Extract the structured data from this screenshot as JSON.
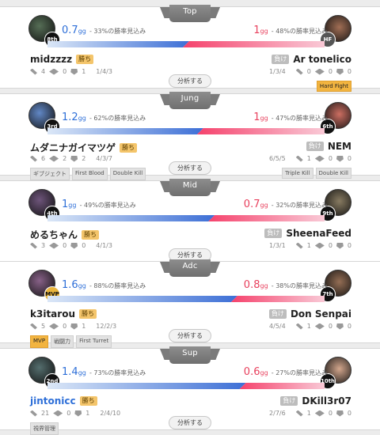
{
  "analyze_label": "分析する",
  "lanes": [
    {
      "role": "Top",
      "left": {
        "gold": "0.7",
        "unit": "gg",
        "winrate": "- 33%の勝率見込み",
        "name": "midzzzz",
        "result": "勝ち",
        "wards": "4",
        "kills": "0",
        "deaths": "1",
        "kda": "1/4/3",
        "rank": "8th",
        "tags": []
      },
      "right": {
        "gold": "1",
        "unit": "gg",
        "winrate": "- 48%の勝率見込み",
        "name": "Ar tonelico",
        "result": "負け",
        "wards": "0",
        "kills": "0",
        "deaths": "0",
        "kda": "1/3/4",
        "rank": "HF",
        "tags": [
          "Hard Fight"
        ]
      },
      "blue_fraction": 0.5
    },
    {
      "role": "Jung",
      "left": {
        "gold": "1.2",
        "unit": "gg",
        "winrate": "- 62%の勝率見込み",
        "name": "ムダニナガイマツゲ",
        "result": "勝ち",
        "wards": "6",
        "kills": "2",
        "deaths": "2",
        "kda": "4/3/7",
        "rank": "3rd",
        "tags": [
          "ギブジェクト",
          "First Blood",
          "Double Kill"
        ]
      },
      "right": {
        "gold": "1",
        "unit": "gg",
        "winrate": "- 47%の勝率見込み",
        "name": "NEM",
        "result": "負け",
        "wards": "1",
        "kills": "0",
        "deaths": "0",
        "kda": "6/5/5",
        "rank": "6th",
        "tags": [
          "Triple Kill",
          "Double Kill"
        ]
      },
      "blue_fraction": 0.55
    },
    {
      "role": "Mid",
      "left": {
        "gold": "1",
        "unit": "gg",
        "winrate": "- 49%の勝率見込み",
        "name": "めるちゃん",
        "result": "勝ち",
        "wards": "3",
        "kills": "0",
        "deaths": "0",
        "kda": "4/1/3",
        "rank": "4th",
        "tags": []
      },
      "right": {
        "gold": "0.7",
        "unit": "gg",
        "winrate": "- 32%の勝率見込み",
        "name": "SheenaFeed",
        "result": "負け",
        "wards": "1",
        "kills": "0",
        "deaths": "0",
        "kda": "1/3/1",
        "rank": "9th",
        "tags": []
      },
      "blue_fraction": 0.59
    },
    {
      "role": "Adc",
      "left": {
        "gold": "1.6",
        "unit": "gg",
        "winrate": "- 88%の勝率見込み",
        "name": "k3itarou",
        "result": "勝ち",
        "wards": "5",
        "kills": "0",
        "deaths": "1",
        "kda": "12/2/3",
        "rank": "MVP",
        "tags": [
          "MVP",
          "戦闘力",
          "First Turret"
        ]
      },
      "right": {
        "gold": "0.8",
        "unit": "gg",
        "winrate": "- 38%の勝率見込み",
        "name": "Don Senpai",
        "result": "負け",
        "wards": "1",
        "kills": "0",
        "deaths": "0",
        "kda": "4/5/4",
        "rank": "7th",
        "tags": []
      },
      "blue_fraction": 0.67
    },
    {
      "role": "Sup",
      "left": {
        "gold": "1.4",
        "unit": "gg",
        "winrate": "- 73%の勝率見込み",
        "name": "jintonicc",
        "result": "勝ち",
        "wards": "21",
        "kills": "0",
        "deaths": "1",
        "kda": "2/4/10",
        "rank": "2nd",
        "tags": [
          "視界管理"
        ]
      },
      "right": {
        "gold": "0.6",
        "unit": "gg",
        "winrate": "- 27%の勝率見込み",
        "name": "DKill3r07",
        "result": "負け",
        "wards": "1",
        "kills": "0",
        "deaths": "0",
        "kda": "2/7/6",
        "rank": "10th",
        "tags": []
      },
      "blue_fraction": 0.7
    }
  ],
  "colors": {
    "blue": "#2e6fd8",
    "red": "#e8405d",
    "win": "#f4c56b",
    "lose": "#bdbdbd"
  },
  "icons": [
    "ward-icon",
    "kill-icon",
    "death-icon"
  ]
}
